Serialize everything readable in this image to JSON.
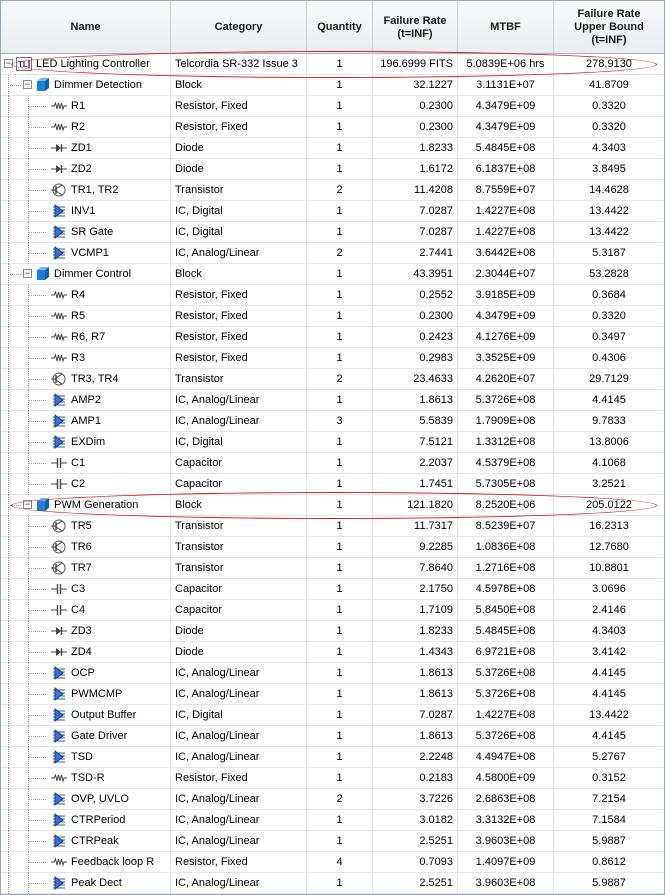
{
  "columns": {
    "name": "Name",
    "category": "Category",
    "quantity": "Quantity",
    "failure_rate": "Failure Rate\n(t=INF)",
    "mtbf": "MTBF",
    "upper_bound": "Failure Rate\nUpper Bound\n(t=INF)"
  },
  "rows": [
    {
      "level": 0,
      "icon": "system-icon",
      "expand": "minus",
      "name": "LED Lighting Controller",
      "category": "Telcordia SR-332 Issue 3",
      "quantity": "1",
      "failure_rate": "196.6999 FITS",
      "mtbf": "5.0839E+06 hrs",
      "upper_bound": "278.9130"
    },
    {
      "level": 1,
      "icon": "block-icon",
      "expand": "minus",
      "name": "Dimmer Detection",
      "category": "Block",
      "quantity": "1",
      "failure_rate": "32.1227",
      "mtbf": "3.1131E+07",
      "upper_bound": "41.8709"
    },
    {
      "level": 2,
      "icon": "resistor-icon",
      "name": "R1",
      "category": "Resistor, Fixed",
      "quantity": "1",
      "failure_rate": "0.2300",
      "mtbf": "4.3479E+09",
      "upper_bound": "0.3320"
    },
    {
      "level": 2,
      "icon": "resistor-icon",
      "name": "R2",
      "category": "Resistor, Fixed",
      "quantity": "1",
      "failure_rate": "0.2300",
      "mtbf": "4.3479E+09",
      "upper_bound": "0.3320"
    },
    {
      "level": 2,
      "icon": "diode-icon",
      "name": "ZD1",
      "category": "Diode",
      "quantity": "1",
      "failure_rate": "1.8233",
      "mtbf": "5.4845E+08",
      "upper_bound": "4.3403"
    },
    {
      "level": 2,
      "icon": "diode-icon",
      "name": "ZD2",
      "category": "Diode",
      "quantity": "1",
      "failure_rate": "1.6172",
      "mtbf": "6.1837E+08",
      "upper_bound": "3.8495"
    },
    {
      "level": 2,
      "icon": "transistor-icon",
      "name": "TR1, TR2",
      "category": "Transistor",
      "quantity": "2",
      "failure_rate": "11.4208",
      "mtbf": "8.7559E+07",
      "upper_bound": "14.4628"
    },
    {
      "level": 2,
      "icon": "ic-icon",
      "name": "INV1",
      "category": "IC, Digital",
      "quantity": "1",
      "failure_rate": "7.0287",
      "mtbf": "1.4227E+08",
      "upper_bound": "13.4422"
    },
    {
      "level": 2,
      "icon": "ic-icon",
      "name": "SR Gate",
      "category": "IC, Digital",
      "quantity": "1",
      "failure_rate": "7.0287",
      "mtbf": "1.4227E+08",
      "upper_bound": "13.4422"
    },
    {
      "level": 2,
      "icon": "ic-icon",
      "name": "VCMP1",
      "category": "IC, Analog/Linear",
      "quantity": "2",
      "failure_rate": "2.7441",
      "mtbf": "3.6442E+08",
      "upper_bound": "5.3187"
    },
    {
      "level": 1,
      "icon": "block-icon",
      "expand": "minus",
      "name": "Dimmer Control",
      "category": "Block",
      "quantity": "1",
      "failure_rate": "43.3951",
      "mtbf": "2.3044E+07",
      "upper_bound": "53.2828"
    },
    {
      "level": 2,
      "icon": "resistor-icon",
      "name": "R4",
      "category": "Resistor, Fixed",
      "quantity": "1",
      "failure_rate": "0.2552",
      "mtbf": "3.9185E+09",
      "upper_bound": "0.3684"
    },
    {
      "level": 2,
      "icon": "resistor-icon",
      "name": "R5",
      "category": "Resistor, Fixed",
      "quantity": "1",
      "failure_rate": "0.2300",
      "mtbf": "4.3479E+09",
      "upper_bound": "0.3320"
    },
    {
      "level": 2,
      "icon": "resistor-icon",
      "name": "R6, R7",
      "category": "Resistor, Fixed",
      "quantity": "1",
      "failure_rate": "0.2423",
      "mtbf": "4.1276E+09",
      "upper_bound": "0.3497"
    },
    {
      "level": 2,
      "icon": "resistor-icon",
      "name": "R3",
      "category": "Resistor, Fixed",
      "quantity": "1",
      "failure_rate": "0.2983",
      "mtbf": "3.3525E+09",
      "upper_bound": "0.4306"
    },
    {
      "level": 2,
      "icon": "transistor-icon",
      "name": "TR3, TR4",
      "category": "Transistor",
      "quantity": "2",
      "failure_rate": "23.4633",
      "mtbf": "4.2620E+07",
      "upper_bound": "29.7129"
    },
    {
      "level": 2,
      "icon": "ic-icon",
      "name": "AMP2",
      "category": "IC, Analog/Linear",
      "quantity": "1",
      "failure_rate": "1.8613",
      "mtbf": "5.3726E+08",
      "upper_bound": "4.4145"
    },
    {
      "level": 2,
      "icon": "ic-icon",
      "name": "AMP1",
      "category": "IC, Analog/Linear",
      "quantity": "3",
      "failure_rate": "5.5839",
      "mtbf": "1.7909E+08",
      "upper_bound": "9.7833"
    },
    {
      "level": 2,
      "icon": "ic-icon",
      "name": "EXDim",
      "category": "IC, Digital",
      "quantity": "1",
      "failure_rate": "7.5121",
      "mtbf": "1.3312E+08",
      "upper_bound": "13.8006"
    },
    {
      "level": 2,
      "icon": "capacitor-icon",
      "name": "C1",
      "category": "Capacitor",
      "quantity": "1",
      "failure_rate": "2.2037",
      "mtbf": "4.5379E+08",
      "upper_bound": "4.1068"
    },
    {
      "level": 2,
      "icon": "capacitor-icon",
      "name": "C2",
      "category": "Capacitor",
      "quantity": "1",
      "failure_rate": "1.7451",
      "mtbf": "5.7305E+08",
      "upper_bound": "3.2521"
    },
    {
      "level": 1,
      "icon": "block-icon",
      "expand": "minus",
      "name": "PWM Generation",
      "category": "Block",
      "quantity": "1",
      "failure_rate": "121.1820",
      "mtbf": "8.2520E+06",
      "upper_bound": "205.0122"
    },
    {
      "level": 2,
      "icon": "transistor-icon",
      "name": "TR5",
      "category": "Transistor",
      "quantity": "1",
      "failure_rate": "11.7317",
      "mtbf": "8.5239E+07",
      "upper_bound": "16.2313"
    },
    {
      "level": 2,
      "icon": "transistor-icon",
      "name": "TR6",
      "category": "Transistor",
      "quantity": "1",
      "failure_rate": "9.2285",
      "mtbf": "1.0836E+08",
      "upper_bound": "12.7680"
    },
    {
      "level": 2,
      "icon": "transistor-icon",
      "name": "TR7",
      "category": "Transistor",
      "quantity": "1",
      "failure_rate": "7.8640",
      "mtbf": "1.2716E+08",
      "upper_bound": "10.8801"
    },
    {
      "level": 2,
      "icon": "capacitor-icon",
      "name": "C3",
      "category": "Capacitor",
      "quantity": "1",
      "failure_rate": "2.1750",
      "mtbf": "4.5978E+08",
      "upper_bound": "3.0696"
    },
    {
      "level": 2,
      "icon": "capacitor-icon",
      "name": "C4",
      "category": "Capacitor",
      "quantity": "1",
      "failure_rate": "1.7109",
      "mtbf": "5.8450E+08",
      "upper_bound": "2.4146"
    },
    {
      "level": 2,
      "icon": "diode-icon",
      "name": "ZD3",
      "category": "Diode",
      "quantity": "1",
      "failure_rate": "1.8233",
      "mtbf": "5.4845E+08",
      "upper_bound": "4.3403"
    },
    {
      "level": 2,
      "icon": "diode-icon",
      "name": "ZD4",
      "category": "Diode",
      "quantity": "1",
      "failure_rate": "1.4343",
      "mtbf": "6.9721E+08",
      "upper_bound": "3.4142"
    },
    {
      "level": 2,
      "icon": "ic-icon",
      "name": "OCP",
      "category": "IC, Analog/Linear",
      "quantity": "1",
      "failure_rate": "1.8613",
      "mtbf": "5.3726E+08",
      "upper_bound": "4.4145"
    },
    {
      "level": 2,
      "icon": "ic-icon",
      "name": "PWMCMP",
      "category": "IC, Analog/Linear",
      "quantity": "1",
      "failure_rate": "1.8613",
      "mtbf": "5.3726E+08",
      "upper_bound": "4.4145"
    },
    {
      "level": 2,
      "icon": "ic-icon",
      "name": "Output Buffer",
      "category": "IC, Digital",
      "quantity": "1",
      "failure_rate": "7.0287",
      "mtbf": "1.4227E+08",
      "upper_bound": "13.4422"
    },
    {
      "level": 2,
      "icon": "ic-icon",
      "name": "Gate Driver",
      "category": "IC, Analog/Linear",
      "quantity": "1",
      "failure_rate": "1.8613",
      "mtbf": "5.3726E+08",
      "upper_bound": "4.4145"
    },
    {
      "level": 2,
      "icon": "ic-icon",
      "name": "TSD",
      "category": "IC, Analog/Linear",
      "quantity": "1",
      "failure_rate": "2.2248",
      "mtbf": "4.4947E+08",
      "upper_bound": "5.2767"
    },
    {
      "level": 2,
      "icon": "resistor-icon",
      "name": "TSD-R",
      "category": "Resistor, Fixed",
      "quantity": "1",
      "failure_rate": "0.2183",
      "mtbf": "4.5800E+09",
      "upper_bound": "0.3152"
    },
    {
      "level": 2,
      "icon": "ic-icon",
      "name": "OVP, UVLO",
      "category": "IC, Analog/Linear",
      "quantity": "2",
      "failure_rate": "3.7226",
      "mtbf": "2.6863E+08",
      "upper_bound": "7.2154"
    },
    {
      "level": 2,
      "icon": "ic-icon",
      "name": "CTRPeriod",
      "category": "IC, Analog/Linear",
      "quantity": "1",
      "failure_rate": "3.0182",
      "mtbf": "3.3132E+08",
      "upper_bound": "7.1584"
    },
    {
      "level": 2,
      "icon": "ic-icon",
      "name": "CTRPeak",
      "category": "IC, Analog/Linear",
      "quantity": "1",
      "failure_rate": "2.5251",
      "mtbf": "3.9603E+08",
      "upper_bound": "5.9887"
    },
    {
      "level": 2,
      "icon": "resistor-icon",
      "name": "Feedback loop R",
      "category": "Resistor, Fixed",
      "quantity": "4",
      "failure_rate": "0.7093",
      "mtbf": "1.4097E+09",
      "upper_bound": "0.8612"
    },
    {
      "level": 2,
      "icon": "ic-icon",
      "name": "Peak Dect",
      "category": "IC, Analog/Linear",
      "quantity": "1",
      "failure_rate": "2.5251",
      "mtbf": "3.9603E+08",
      "upper_bound": "5.9887"
    }
  ],
  "highlights": [
    {
      "row": 0,
      "label": "highlight-led-lighting-controller"
    },
    {
      "row": 21,
      "label": "highlight-pwm-generation"
    }
  ],
  "colors": {
    "highlight": "#d21c1c",
    "block_icon": "#1e7fd8",
    "ic_icon": "#2a5db0"
  }
}
